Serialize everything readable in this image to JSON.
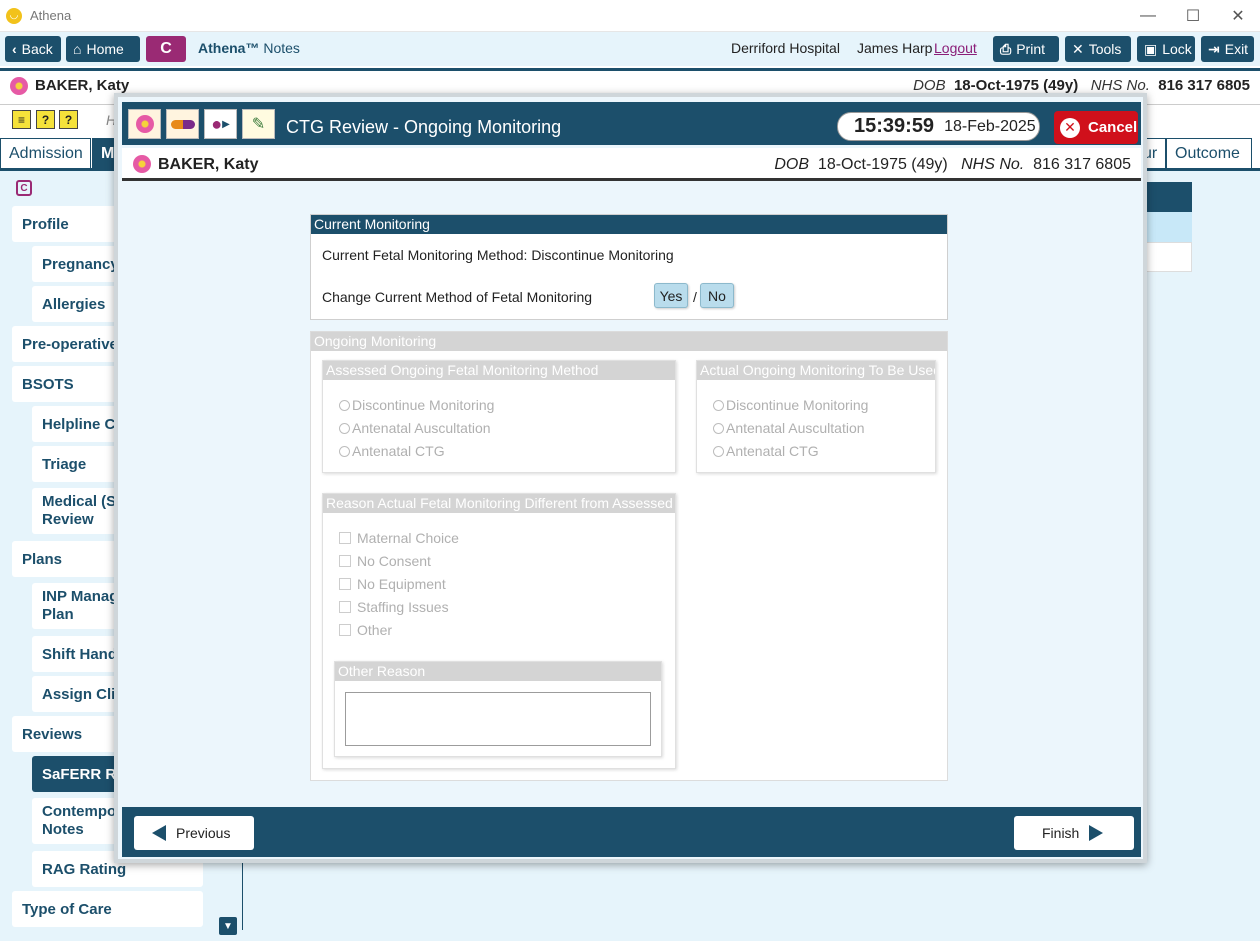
{
  "window": {
    "app_name": "Athena",
    "minimize": "—",
    "maximize": "☐",
    "close": "✕"
  },
  "toolbar": {
    "back": "Back",
    "home": "Home",
    "c_label": "C",
    "brand": "Athena™",
    "brand_suffix": "Notes",
    "hospital": "Derriford Hospital",
    "user": "James Harp",
    "logout": "Logout",
    "print": "Print",
    "tools": "Tools",
    "lock": "Lock",
    "exit": "Exit"
  },
  "patient": {
    "name": "BAKER, Katy",
    "dob_label": "DOB",
    "dob": "18-Oct-1975 (49y)",
    "nhs_label": "NHS No.",
    "nhs": "816 317 6805"
  },
  "tabs": {
    "admission": "Admission",
    "active_partial": "M",
    "partial_right": "ur",
    "outcome": "Outcome",
    "h_partial": "H"
  },
  "sidebar": {
    "items": [
      "Profile",
      "Pregnancy",
      "Allergies",
      "Pre-operative",
      "BSOTS",
      "Helpline Co",
      "Triage",
      "Medical (Sa",
      "Review",
      "Plans",
      "INP Manag",
      "Plan",
      "Shift Hande",
      "Assign Clin",
      "Reviews",
      "SaFERR Rev",
      "Contempor",
      "Notes",
      "RAG Rating",
      "Type of Care"
    ]
  },
  "modal": {
    "title": "CTG Review - Ongoing Monitoring",
    "time": "15:39:59",
    "date": "18-Feb-2025",
    "cancel": "Cancel",
    "current_monitoring": {
      "title": "Current Monitoring",
      "method_text": "Current Fetal Monitoring Method: Discontinue Monitoring",
      "change_label": "Change Current Method of Fetal Monitoring",
      "yes": "Yes",
      "slash": "/",
      "no": "No"
    },
    "ongoing": {
      "title": "Ongoing Monitoring",
      "assessed": {
        "title": "Assessed Ongoing Fetal Monitoring Method",
        "options": [
          "Discontinue Monitoring",
          "Antenatal Auscultation",
          "Antenatal CTG"
        ]
      },
      "actual": {
        "title": "Actual Ongoing Monitoring To Be Used",
        "options": [
          "Discontinue Monitoring",
          "Antenatal Auscultation",
          "Antenatal CTG"
        ]
      },
      "reason": {
        "title": "Reason Actual Fetal Monitoring Different from Assessed",
        "options": [
          "Maternal Choice",
          "No Consent",
          "No Equipment",
          "Staffing Issues",
          "Other"
        ],
        "other_reason_title": "Other Reason",
        "other_reason_value": ""
      }
    },
    "footer": {
      "previous": "Previous",
      "finish": "Finish"
    }
  },
  "colors": {
    "primary": "#1c4f6b",
    "accent": "#9a2a74",
    "cancel": "#d0101b",
    "background": "#e6f4fb"
  }
}
